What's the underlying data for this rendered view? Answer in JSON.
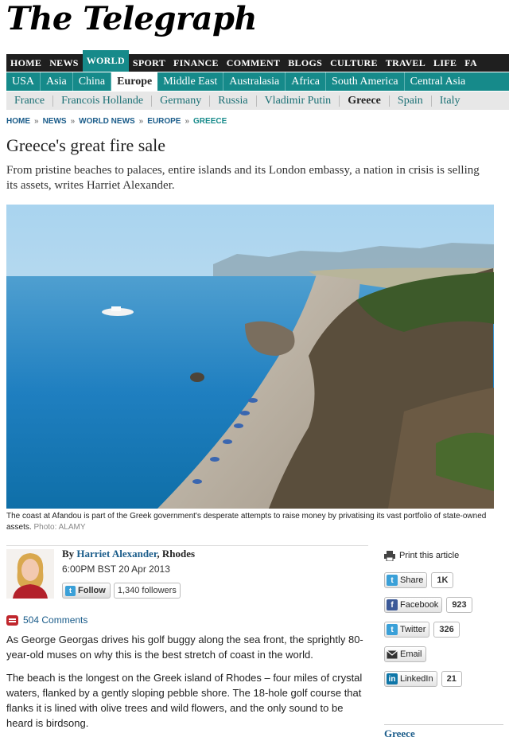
{
  "masthead": {
    "logo": "The Telegraph"
  },
  "nav_primary": [
    "HOME",
    "NEWS",
    "WORLD",
    "SPORT",
    "FINANCE",
    "COMMENT",
    "BLOGS",
    "CULTURE",
    "TRAVEL",
    "LIFE",
    "FA"
  ],
  "nav_primary_active": "WORLD",
  "nav_regions": [
    "USA",
    "Asia",
    "China",
    "Europe",
    "Middle East",
    "Australasia",
    "Africa",
    "South America",
    "Central Asia"
  ],
  "nav_regions_active": "Europe",
  "nav_topics": [
    "France",
    "Francois Hollande",
    "Germany",
    "Russia",
    "Vladimir Putin",
    "Greece",
    "Spain",
    "Italy"
  ],
  "nav_topics_active": "Greece",
  "breadcrumb": [
    "HOME",
    "NEWS",
    "WORLD NEWS",
    "EUROPE",
    "GREECE"
  ],
  "breadcrumb_sep": "»",
  "article": {
    "title": "Greece's great fire sale",
    "standfirst": "From pristine beaches to palaces, entire islands and its London embassy, a nation in crisis is selling its assets, writes Harriet Alexander.",
    "caption": "The coast at Afandou is part of the Greek government's desperate attempts to raise money by privatising its vast portfolio of state-owned assets.",
    "photo_credit": "Photo: ALAMY",
    "byline_prefix": "By",
    "author": "Harriet Alexander",
    "location": ", Rhodes",
    "dateline": "6:00PM BST 20 Apr 2013",
    "follow_label": "Follow",
    "followers": "1,340 followers",
    "comments": "504 Comments",
    "paragraphs": [
      "As George Georgas drives his golf buggy along the sea front, the sprightly 80-year-old muses on why this is the best stretch of coast in the world.",
      "The beach is the longest on the Greek island of Rhodes – four miles of crystal waters, flanked by a gently sloping pebble shore. The 18-hole golf course that flanks it is lined with olive trees and wild flowers, and the only sound to be heard is birdsong."
    ]
  },
  "sidebar": {
    "print_label": "Print this article",
    "share": [
      {
        "label": "Share",
        "count": "1K",
        "icon": "twitter-share-icon",
        "color": "#3aa0d8"
      },
      {
        "label": "Facebook",
        "count": "923",
        "icon": "facebook-icon",
        "color": "#3b5998"
      },
      {
        "label": "Twitter",
        "count": "326",
        "icon": "twitter-icon",
        "color": "#3aa0d8"
      },
      {
        "label": "Email",
        "count": "",
        "icon": "email-icon",
        "color": "#333333"
      },
      {
        "label": "LinkedIn",
        "count": "21",
        "icon": "linkedin-icon",
        "color": "#0e76a8"
      }
    ],
    "section_heading": "Greece"
  },
  "colors": {
    "teal": "#168a8a",
    "dark_nav": "#1f1f1f",
    "link": "#1a5c8a",
    "comment_red": "#c0272d"
  }
}
